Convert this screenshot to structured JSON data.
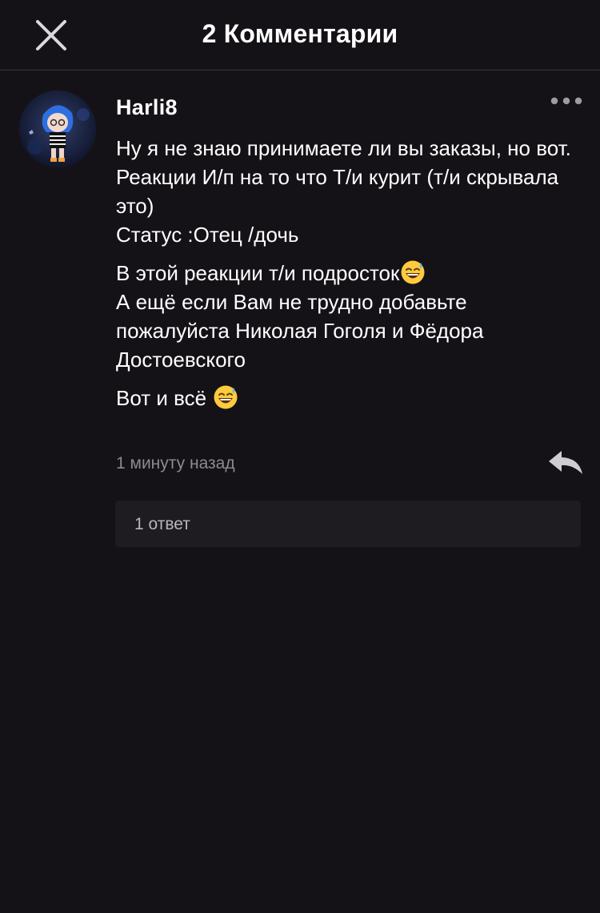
{
  "header": {
    "title": "2 Комментарии",
    "close_icon": "close-icon"
  },
  "comment": {
    "author": "Harli8",
    "more_icon": "more-horizontal-icon",
    "paragraphs": [
      "Ну я не знаю принимаете ли вы заказы, но вот.\nРеакции И/п на то что Т/и курит (т/и скрывала это)\nСтатус :Отец /дочь",
      "В этой реакции т/и подросток",
      "А ещё если Вам не трудно добавьте пожалуйста Николая Гоголя и Фёдора Достоевского",
      "Вот и всё "
    ],
    "emoji": "grinning-sweat-emoji",
    "timestamp": "1 минуту назад",
    "reply_icon": "reply-arrow-icon",
    "replies_label": "1 ответ"
  },
  "colors": {
    "background": "#141216",
    "muted_text": "#8c8a90",
    "reply_box": "#1e1c21"
  }
}
